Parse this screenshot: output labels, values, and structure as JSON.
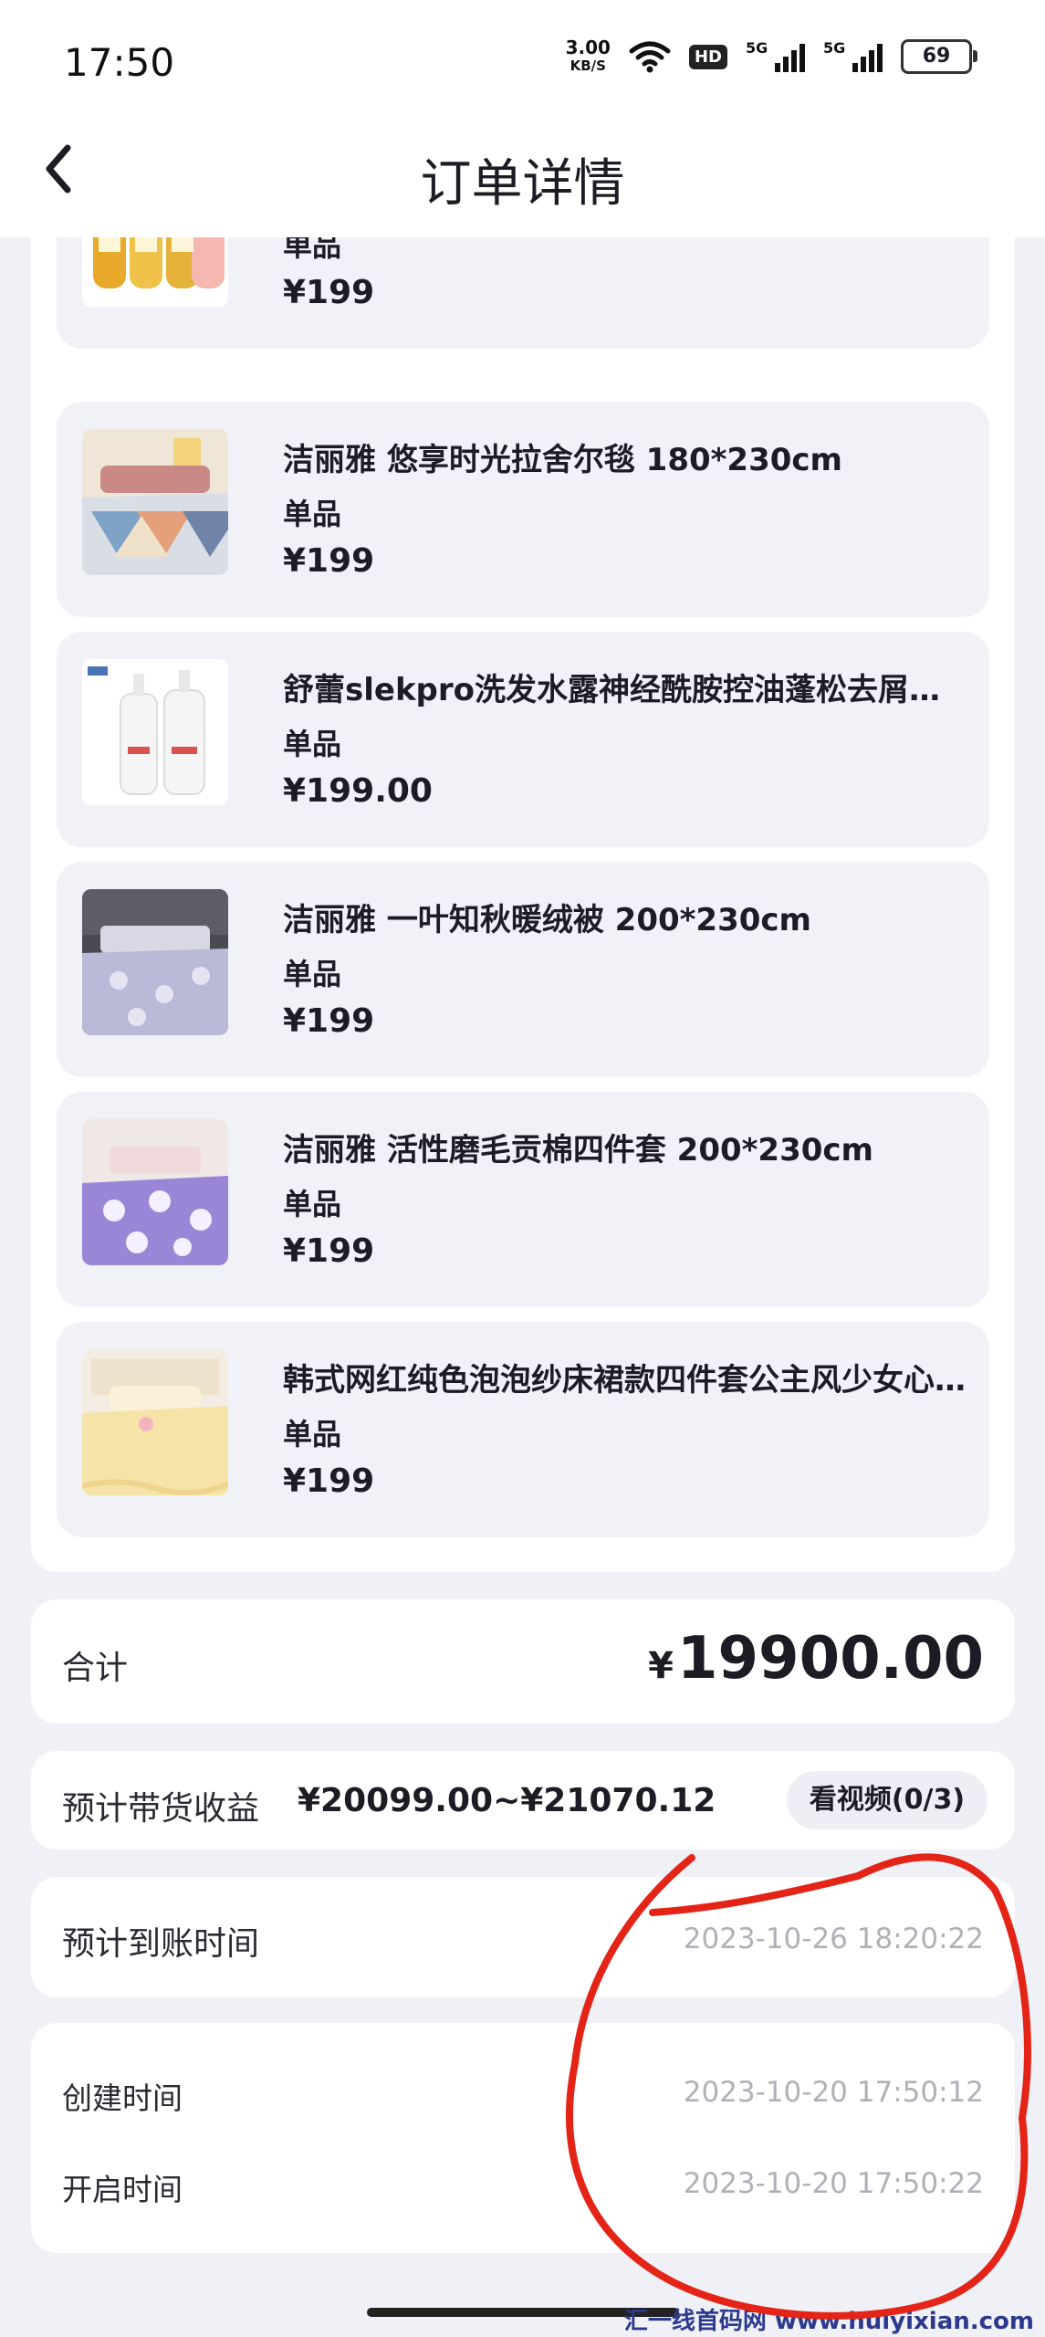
{
  "status_bar": {
    "time": "17:50",
    "net_speed_value": "3.00",
    "net_speed_unit": "KB/S",
    "wifi_icon": "wifi-icon",
    "hd_badge": "HD",
    "signal_1_label": "5G",
    "signal_2_label": "5G",
    "battery_level": "69"
  },
  "header": {
    "title": "订单详情",
    "back_icon": "chevron-left-icon"
  },
  "items": [
    {
      "name": "",
      "type": "单品",
      "price": "¥199",
      "thumb_icon": "shampoo-bottles-image"
    },
    {
      "name": "洁丽雅 悠享时光拉舍尔毯 180*230cm",
      "type": "单品",
      "price": "¥199",
      "thumb_icon": "blanket-bed-image"
    },
    {
      "name": "舒蕾slekpro洗发水露神经酰胺控油蓬松去屑止痒洗发水",
      "type": "单品",
      "price": "¥199.00",
      "thumb_icon": "white-bottles-image"
    },
    {
      "name": "洁丽雅 一叶知秋暖绒被 200*230cm",
      "type": "单品",
      "price": "¥199",
      "thumb_icon": "quilt-bed-image"
    },
    {
      "name": "洁丽雅 活性磨毛贡棉四件套 200*230cm",
      "type": "单品",
      "price": "¥199",
      "thumb_icon": "purple-bedding-image"
    },
    {
      "name": "韩式网红纯色泡泡纱床裙款四件套公主风少女心床上用品",
      "type": "单品",
      "price": "¥199",
      "thumb_icon": "yellow-bedding-image"
    }
  ],
  "total": {
    "label": "合计",
    "currency": "¥",
    "amount": "19900.00"
  },
  "earnings": {
    "label": "预计带货收益",
    "value": "¥20099.00~¥21070.12",
    "video_button": "看视频(0/3)"
  },
  "arrival": {
    "label": "预计到账时间",
    "value": "2023-10-26 18:20:22"
  },
  "times": {
    "created_label": "创建时间",
    "created_value": "2023-10-20 17:50:12",
    "opened_label": "开启时间",
    "opened_value": "2023-10-20 17:50:22"
  },
  "watermark": "汇一线首码网 www.huiyixian.com",
  "colors": {
    "page_bg": "#f0f0f7",
    "card_bg": "#ffffff",
    "item_bg": "#f1f1f8",
    "time_text": "#b0b0b8",
    "annotation_red": "#e32416"
  }
}
